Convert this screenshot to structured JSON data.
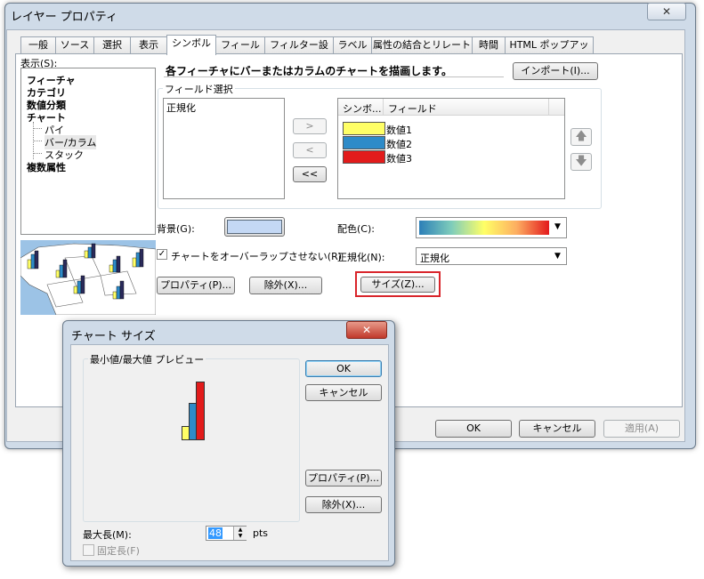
{
  "main_window": {
    "title": "レイヤー プロパティ",
    "close_glyph": "✕",
    "tabs": [
      "一般",
      "ソース",
      "選択",
      "表示",
      "シンボル",
      "フィールド",
      "フィルター設定",
      "ラベル",
      "属性の結合とリレート",
      "時間",
      "HTML ポップアップ"
    ],
    "active_tab": "シンボル"
  },
  "show": {
    "label": "表示(S):",
    "tree": [
      {
        "label": "フィーチャ",
        "bold": true
      },
      {
        "label": "カテゴリ",
        "bold": true
      },
      {
        "label": "数値分類",
        "bold": true
      },
      {
        "label": "チャート",
        "bold": true
      },
      {
        "label": "パイ",
        "bold": false
      },
      {
        "label": "バー/カラム",
        "bold": false,
        "selected": true
      },
      {
        "label": "スタック",
        "bold": false
      },
      {
        "label": "複数属性",
        "bold": true
      }
    ]
  },
  "description": "各フィーチャにバーまたはカラムのチャートを描画します。",
  "import_button": "インポート(I)...",
  "field_selection": {
    "group_label": "フィールド選択",
    "available_fields": [
      "正規化"
    ],
    "move_right": ">",
    "move_left": "<",
    "move_all_left": "<<",
    "columns": [
      "シンボ...",
      "フィールド"
    ],
    "selected_fields": [
      {
        "field": "数値1",
        "color": "#ffff66"
      },
      {
        "field": "数値2",
        "color": "#2e8bc8"
      },
      {
        "field": "数値3",
        "color": "#e21b1b"
      }
    ],
    "up_glyph": "🡅",
    "down_glyph": "🡇"
  },
  "background": {
    "label": "背景(G):",
    "color": "#c4d8f4"
  },
  "color_scheme": {
    "label": "配色(C):",
    "colors": [
      "#2c7fb8",
      "#7fcdbb",
      "#ffff66",
      "#fdae61",
      "#e31a1c"
    ]
  },
  "no_overlap": {
    "label": "チャートをオーバーラップさせない(R)",
    "checked": true
  },
  "normalization": {
    "label": "正規化(N):",
    "value": "正規化"
  },
  "properties_button": "プロパティ(P)...",
  "exclude_button": "除外(X)...",
  "size_button": "サイズ(Z)...",
  "footer": {
    "ok": "OK",
    "cancel": "キャンセル",
    "apply": "適用(A)"
  },
  "chart_size_dialog": {
    "title": "チャート サイズ",
    "close_glyph": "✕",
    "preview_label": "最小値/最大値 プレビュー",
    "ok": "OK",
    "cancel": "キャンセル",
    "properties": "プロパティ(P)...",
    "exclude": "除外(X)...",
    "max_length_label": "最大長(M):",
    "max_length_value": "48",
    "unit": "pts",
    "fixed_length": {
      "label": "固定長(F)",
      "checked": false
    },
    "preview_bar_colors": [
      "#ffff66",
      "#2e8bc8",
      "#e21b1b"
    ]
  },
  "colors": {
    "highlight": "#d9252b",
    "selection": "#3399ff",
    "window_frame": "#cfdbe8"
  }
}
